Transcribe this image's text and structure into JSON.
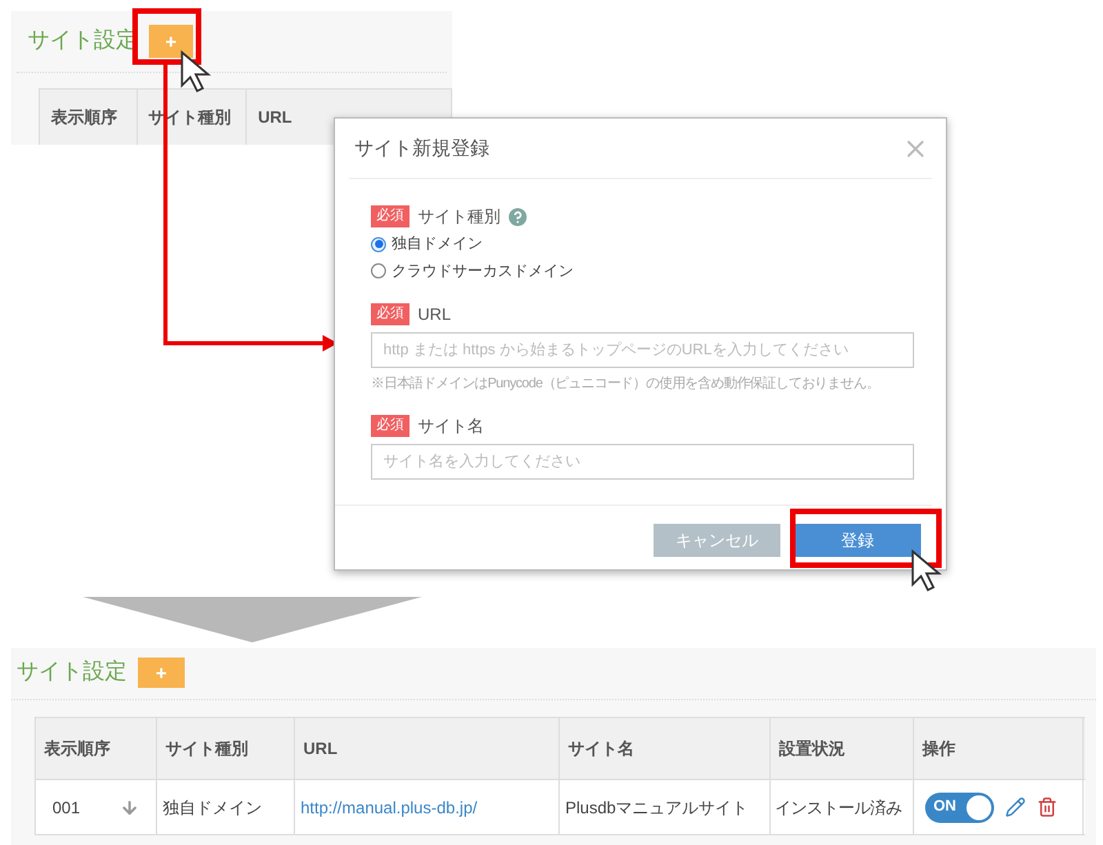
{
  "before": {
    "title": "サイト設定",
    "add_button": "+",
    "columns": [
      "表示順序",
      "サイト種別",
      "URL"
    ]
  },
  "dialog": {
    "title": "サイト新規登録",
    "site_type": {
      "badge": "必須",
      "label": "サイト種別",
      "options": [
        {
          "label": "独自ドメイン",
          "selected": true
        },
        {
          "label": "クラウドサーカスドメイン",
          "selected": false
        }
      ]
    },
    "url": {
      "badge": "必須",
      "label": "URL",
      "placeholder": "http または https から始まるトップページのURLを入力してください",
      "note": "※日本語ドメインはPunycode（ピュニコード）の使用を含め動作保証しておりません。"
    },
    "site_name": {
      "badge": "必須",
      "label": "サイト名",
      "placeholder": "サイト名を入力してください"
    },
    "buttons": [
      {
        "kind": "cancel",
        "label": "キャンセル"
      },
      {
        "kind": "submit",
        "label": "登録"
      }
    ]
  },
  "after": {
    "title": "サイト設定",
    "add_button": "+",
    "columns": [
      "表示順序",
      "サイト種別",
      "URL",
      "サイト名",
      "設置状況",
      "操作"
    ],
    "rows": [
      {
        "order": "001",
        "type": "独自ドメイン",
        "url": "http://manual.plus-db.jp/",
        "name": "Plusdbマニュアルサイト",
        "status": "インストール済み",
        "on": true,
        "toggle": "ON"
      }
    ]
  }
}
